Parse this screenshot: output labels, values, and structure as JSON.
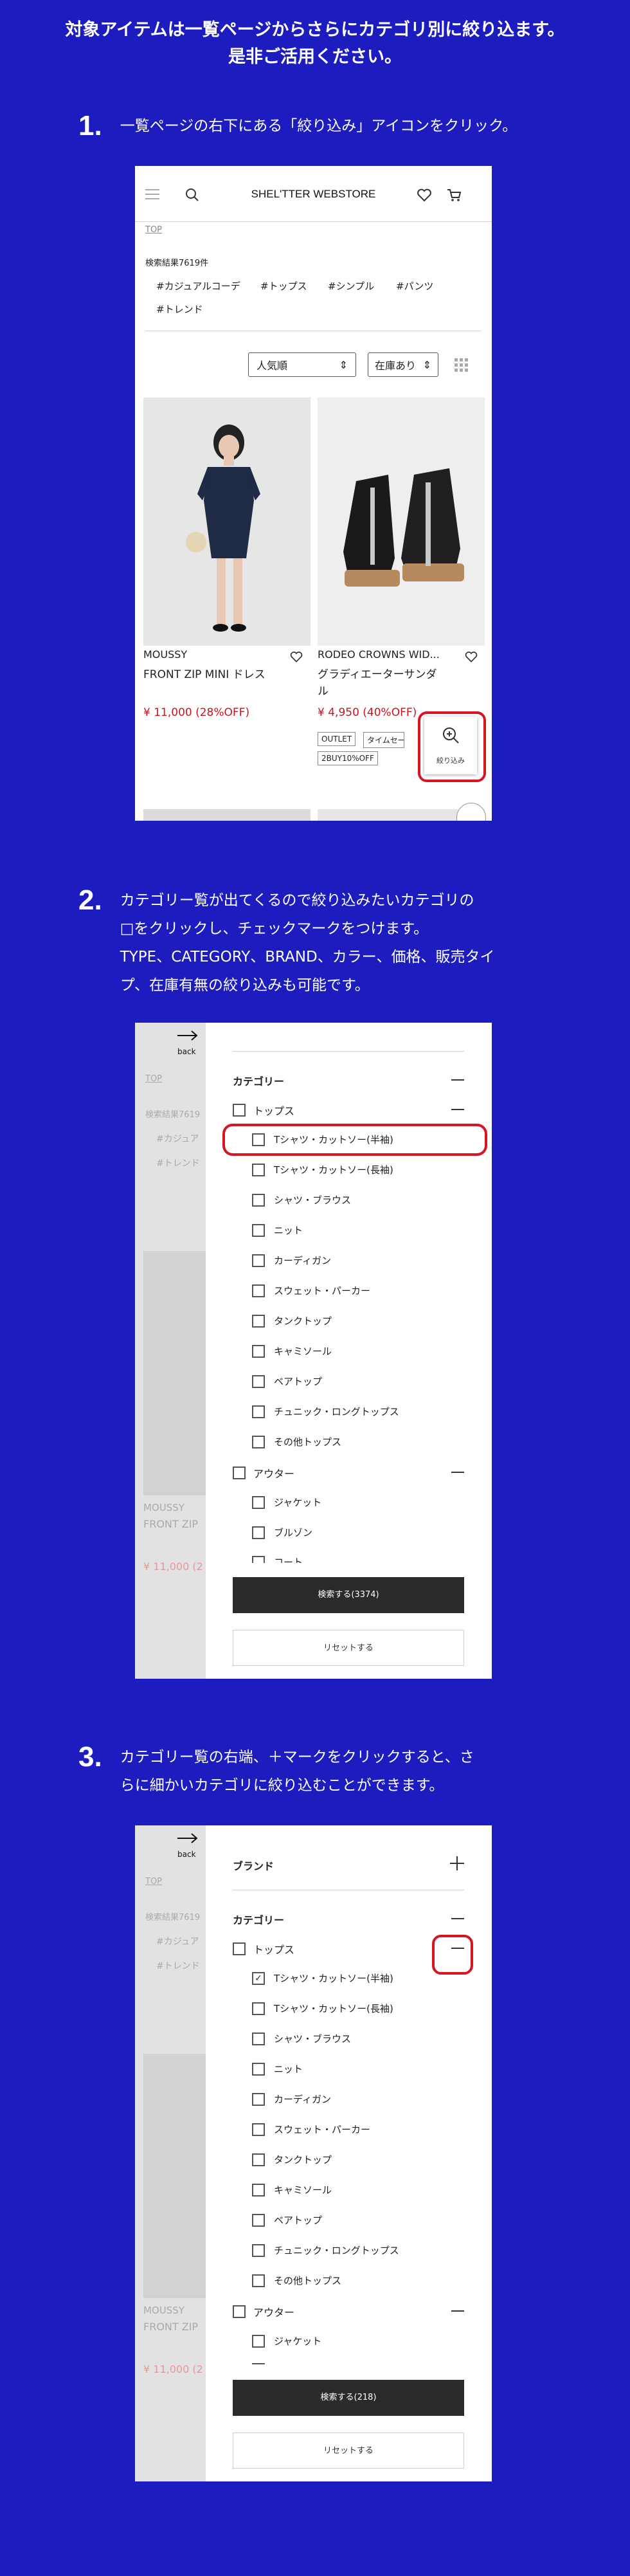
{
  "intro": {
    "line1": "対象アイテムは一覧ページからさらにカテゴリ別に絞り込ます。",
    "line2": "是非ご活用ください。"
  },
  "step1": {
    "num": "1.",
    "text": "一覧ページの右下にある「絞り込み」アイコンをクリック。"
  },
  "step2": {
    "num": "2.",
    "lines": [
      "カテゴリー覧が出てくるので絞り込みたいカテゴリの",
      "□をクリックし、チェックマークをつけます。",
      "TYPE、CATEGORY、BRAND、カラー、価格、販売タイ",
      "プ、在庫有無の絞り込みも可能です。"
    ]
  },
  "step3": {
    "num": "3.",
    "lines": [
      "カテゴリー覧の右端、＋マークをクリックすると、さ",
      "らに細かいカテゴリに絞り込むことができます。"
    ]
  },
  "store": {
    "logo": "SHEL'TTER WEBSTORE",
    "breadcrumb": "TOP",
    "result": "検索結果7619件",
    "tags": [
      "#カジュアルコーデ",
      "#トップス",
      "#シンプル",
      "#パンツ",
      "#トレンド"
    ],
    "sort": "人気順",
    "stock": "在庫あり",
    "products": [
      {
        "brand": "MOUSSY",
        "name": "FRONT ZIP MINI ドレス",
        "price": "¥ 11,000 (28%OFF)",
        "badges": []
      },
      {
        "brand": "RODEO CROWNS WID...",
        "name1": "グラディエーターサンダ",
        "name2": "ル",
        "price": "¥ 4,950 (40%OFF)",
        "badges": [
          "OUTLET",
          "タイムセール",
          "2BUY10%OFF"
        ]
      }
    ],
    "filter_icon_label": "絞り込み"
  },
  "drawer": {
    "back": "back",
    "brand_label": "ブランド",
    "category_label": "カテゴリー",
    "tops": "トップス",
    "outer": "アウター",
    "items": [
      "Tシャツ・カットソー(半袖)",
      "Tシャツ・カットソー(長袖)",
      "シャツ・ブラウス",
      "ニット",
      "カーディガン",
      "スウェット・パーカー",
      "タンクトップ",
      "キャミソール",
      "ベアトップ",
      "チュニック・ロングトップス",
      "その他トップス"
    ],
    "outer_items2": [
      "ジャケット",
      "ブルゾン",
      "コート"
    ],
    "outer_items3": [
      "ジャケット"
    ],
    "search2": "検索する(3374)",
    "search3": "検索する(218)",
    "reset": "リセットする"
  },
  "bg_text": {
    "top": "TOP",
    "result": "検索結果7619",
    "tag1": "#カジュア",
    "tag2": "#トレンド",
    "brand": "MOUSSY",
    "name": "FRONT ZIP",
    "price": "¥ 11,000 (2"
  },
  "colors": {
    "background": "#1d1cbf",
    "highlight": "#d8141f",
    "price": "#c8141e"
  }
}
